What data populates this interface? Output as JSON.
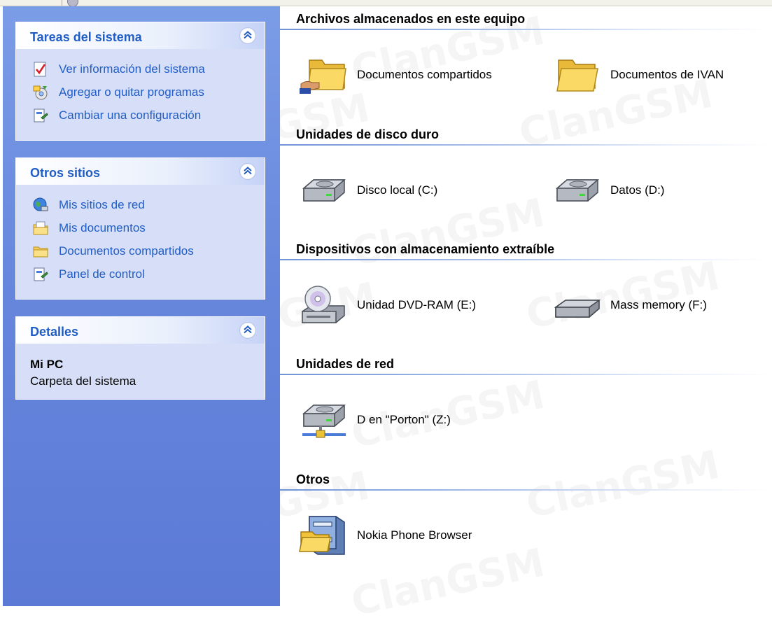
{
  "sidebar": {
    "system_tasks": {
      "title": "Tareas del sistema",
      "items": [
        {
          "label": "Ver información del sistema",
          "icon": "system-info-icon"
        },
        {
          "label": "Agregar o quitar programas",
          "icon": "add-remove-programs-icon"
        },
        {
          "label": "Cambiar una configuración",
          "icon": "control-panel-icon"
        }
      ]
    },
    "other_places": {
      "title": "Otros sitios",
      "items": [
        {
          "label": "Mis sitios de red",
          "icon": "network-places-icon"
        },
        {
          "label": "Mis documentos",
          "icon": "my-documents-icon"
        },
        {
          "label": "Documentos compartidos",
          "icon": "shared-folder-icon"
        },
        {
          "label": "Panel de control",
          "icon": "control-panel-icon"
        }
      ]
    },
    "details": {
      "title": "Detalles",
      "name": "Mi PC",
      "description": "Carpeta del sistema"
    }
  },
  "content": {
    "groups": [
      {
        "title": "Archivos almacenados en este equipo",
        "items": [
          {
            "label": "Documentos compartidos",
            "icon": "shared-folder-icon"
          },
          {
            "label": "Documentos de IVAN",
            "icon": "folder-icon"
          }
        ]
      },
      {
        "title": "Unidades de disco duro",
        "items": [
          {
            "label": "Disco local (C:)",
            "icon": "hard-drive-icon"
          },
          {
            "label": "Datos (D:)",
            "icon": "hard-drive-icon"
          }
        ]
      },
      {
        "title": "Dispositivos con almacenamiento extraíble",
        "items": [
          {
            "label": "Unidad DVD-RAM (E:)",
            "icon": "dvd-drive-icon"
          },
          {
            "label": "Mass memory (F:)",
            "icon": "removable-drive-icon"
          }
        ]
      },
      {
        "title": "Unidades de red",
        "items": [
          {
            "label": "D en \"Porton\" (Z:)",
            "icon": "network-drive-icon"
          }
        ]
      },
      {
        "title": "Otros",
        "items": [
          {
            "label": "Nokia Phone Browser",
            "icon": "nokia-browser-icon"
          }
        ]
      }
    ]
  },
  "colors": {
    "sidebar_blue": "#6787dd",
    "panel_fill": "#d6dff7",
    "link_blue": "#215dc6",
    "rule_blue": "#6f93d6"
  }
}
